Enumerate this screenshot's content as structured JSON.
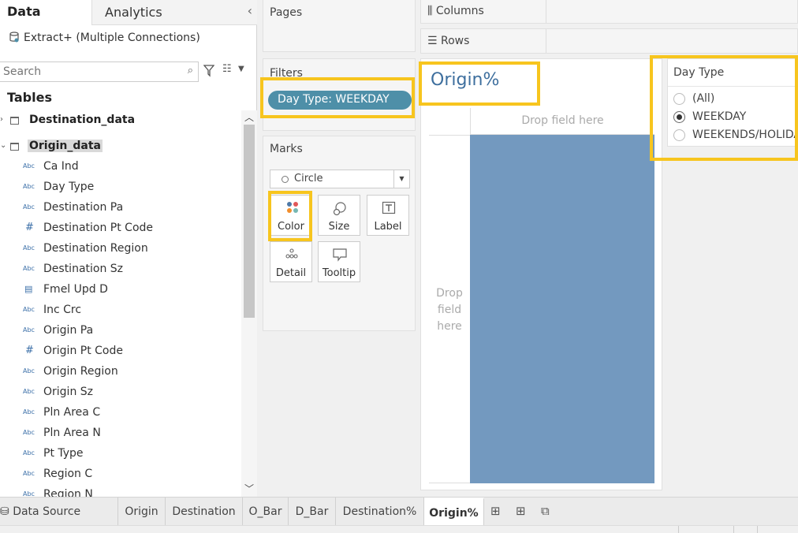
{
  "data_pane": {
    "tab_data": "Data",
    "tab_analytics": "Analytics",
    "collapse_glyph": "‹",
    "connection": "Extract+ (Multiple Connections)",
    "search_placeholder": "Search",
    "tables_heading": "Tables",
    "tables": [
      {
        "name": "Destination_data",
        "expanded": false
      },
      {
        "name": "Origin_data",
        "expanded": true,
        "selected": true
      }
    ],
    "fields": [
      {
        "type": "Abc",
        "name": "Ca Ind"
      },
      {
        "type": "Abc",
        "name": "Day Type"
      },
      {
        "type": "Abc",
        "name": "Destination Pa"
      },
      {
        "type": "#",
        "name": "Destination Pt Code"
      },
      {
        "type": "Abc",
        "name": "Destination Region"
      },
      {
        "type": "Abc",
        "name": "Destination Sz"
      },
      {
        "type": "date",
        "name": "Fmel Upd D"
      },
      {
        "type": "Abc",
        "name": "Inc Crc"
      },
      {
        "type": "Abc",
        "name": "Origin Pa"
      },
      {
        "type": "#",
        "name": "Origin Pt Code"
      },
      {
        "type": "Abc",
        "name": "Origin Region"
      },
      {
        "type": "Abc",
        "name": "Origin Sz"
      },
      {
        "type": "Abc",
        "name": "Pln Area C"
      },
      {
        "type": "Abc",
        "name": "Pln Area N"
      },
      {
        "type": "Abc",
        "name": "Pt Type"
      },
      {
        "type": "Abc",
        "name": "Region C"
      },
      {
        "type": "Abc",
        "name": "Region N"
      }
    ]
  },
  "shelves": {
    "pages": "Pages",
    "filters": "Filters",
    "filter_pill": "Day Type: WEEKDAY",
    "marks": "Marks",
    "mark_type": "Circle",
    "mark_buttons": {
      "color": "Color",
      "size": "Size",
      "label": "Label",
      "detail": "Detail",
      "tooltip": "Tooltip"
    },
    "columns": "Columns",
    "rows": "Rows"
  },
  "canvas": {
    "title": "Origin%",
    "drop_top": "Drop field here",
    "drop_left_1": "Drop",
    "drop_left_2": "field",
    "drop_left_3": "here",
    "plot_color": "#7399bf"
  },
  "legend": {
    "title": "Day Type",
    "options": [
      {
        "label": "(All)",
        "selected": false
      },
      {
        "label": "WEEKDAY",
        "selected": true
      },
      {
        "label": "WEEKENDS/HOLIDAY",
        "selected": false
      }
    ]
  },
  "sheet_tabs": {
    "data_source": "Data Source",
    "tabs": [
      "Origin",
      "Destination",
      "O_Bar",
      "D_Bar",
      "Destination%",
      "Origin%"
    ],
    "active": "Origin%"
  },
  "colors": {
    "highlight": "#f7c51e",
    "accent": "#3e6f9e",
    "pill": "#4e8fa8"
  }
}
